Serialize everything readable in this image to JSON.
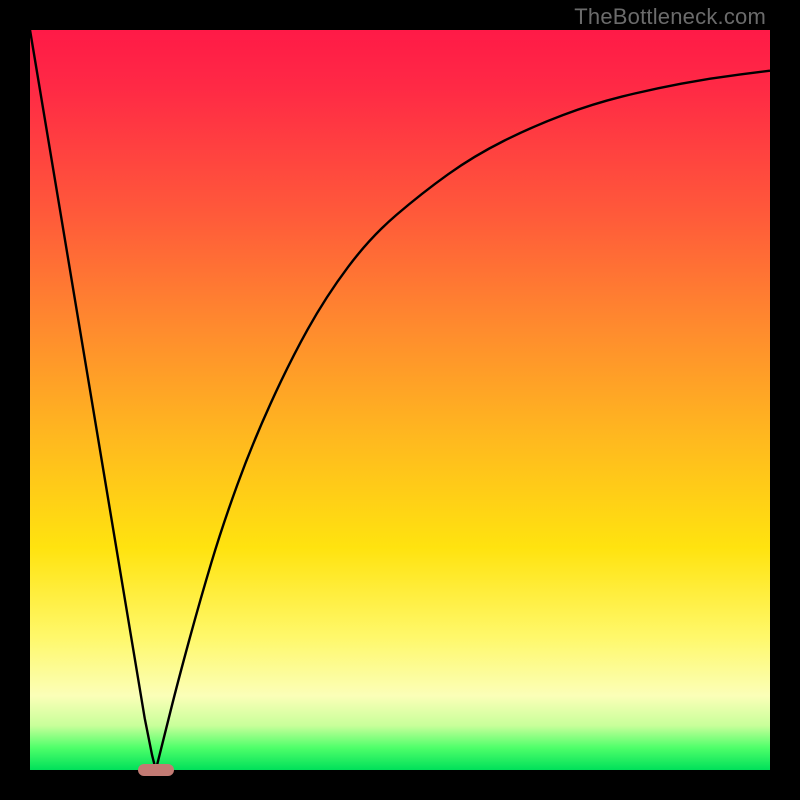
{
  "watermark": "TheBottleneck.com",
  "colors": {
    "background": "#000000",
    "gradient_top": "#ff1a47",
    "gradient_mid": "#ffe30f",
    "gradient_bottom": "#00e05a",
    "curve": "#000000",
    "marker": "#c27a73"
  },
  "chart_data": {
    "type": "line",
    "title": "",
    "xlabel": "",
    "ylabel": "",
    "xlim": [
      0,
      100
    ],
    "ylim": [
      0,
      100
    ],
    "grid": false,
    "legend": false,
    "annotations": [
      {
        "type": "pill-marker",
        "x": 17,
        "y": 0
      }
    ],
    "series": [
      {
        "name": "left-descent",
        "type": "line",
        "x": [
          0,
          2,
          4,
          6,
          8,
          10,
          12,
          14,
          15.5,
          16.5,
          17
        ],
        "values": [
          100,
          88,
          76,
          64,
          52,
          40,
          28,
          16,
          7,
          2,
          0
        ]
      },
      {
        "name": "right-curve",
        "type": "line",
        "x": [
          17,
          18,
          20,
          23,
          26,
          30,
          35,
          40,
          46,
          53,
          60,
          68,
          76,
          84,
          92,
          100
        ],
        "values": [
          0,
          4,
          12,
          23,
          33,
          44,
          55,
          64,
          72,
          78,
          83,
          87,
          90,
          92,
          93.5,
          94.5
        ]
      }
    ]
  }
}
